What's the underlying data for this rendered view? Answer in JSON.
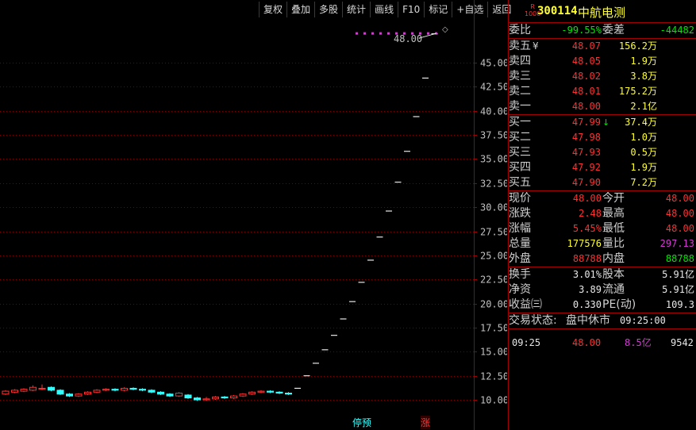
{
  "toolbar": [
    "复权",
    "叠加",
    "多股",
    "统计",
    "画线",
    "F10",
    "标记",
    "+自选",
    "返回"
  ],
  "chart": {
    "y_labels": [
      "45.00",
      "42.50",
      "40.00",
      "37.50",
      "35.00",
      "32.50",
      "30.00",
      "27.50",
      "25.00",
      "22.50",
      "20.00",
      "17.50",
      "15.00",
      "12.50",
      "10.00"
    ],
    "last_price_label": "48.00",
    "diamond": "◇",
    "halt_tag": "停预",
    "rise_tag": "涨",
    "colors": {
      "up": "#ff3030",
      "down": "#33ffff",
      "line": "#d23cd2"
    }
  },
  "chart_data": {
    "type": "candlestick",
    "ylim": [
      9.0,
      48.5
    ],
    "y_ticks": [
      45.0,
      42.5,
      40.0,
      37.5,
      35.0,
      32.5,
      30.0,
      27.5,
      25.0,
      22.5,
      20.0,
      17.5,
      15.0,
      12.5,
      10.0
    ],
    "candles": [
      {
        "o": 10.6,
        "c": 10.9,
        "h": 11.0,
        "l": 10.5
      },
      {
        "o": 10.8,
        "c": 11.0,
        "h": 11.1,
        "l": 10.7
      },
      {
        "o": 10.9,
        "c": 11.1,
        "h": 11.2,
        "l": 10.8
      },
      {
        "o": 11.0,
        "c": 11.3,
        "h": 11.5,
        "l": 10.9
      },
      {
        "o": 11.2,
        "c": 11.2,
        "h": 11.6,
        "l": 11.0
      },
      {
        "o": 11.3,
        "c": 11.0,
        "h": 11.4,
        "l": 10.9
      },
      {
        "o": 11.0,
        "c": 10.6,
        "h": 11.1,
        "l": 10.5
      },
      {
        "o": 10.6,
        "c": 10.4,
        "h": 10.7,
        "l": 10.3
      },
      {
        "o": 10.4,
        "c": 10.6,
        "h": 10.7,
        "l": 10.3
      },
      {
        "o": 10.6,
        "c": 10.8,
        "h": 10.9,
        "l": 10.5
      },
      {
        "o": 10.8,
        "c": 11.0,
        "h": 11.1,
        "l": 10.7
      },
      {
        "o": 11.0,
        "c": 11.1,
        "h": 11.2,
        "l": 10.9
      },
      {
        "o": 11.1,
        "c": 11.0,
        "h": 11.2,
        "l": 10.9
      },
      {
        "o": 11.0,
        "c": 11.2,
        "h": 11.3,
        "l": 10.9
      },
      {
        "o": 11.2,
        "c": 11.1,
        "h": 11.3,
        "l": 11.0
      },
      {
        "o": 11.1,
        "c": 11.0,
        "h": 11.2,
        "l": 10.9
      },
      {
        "o": 11.0,
        "c": 10.8,
        "h": 11.1,
        "l": 10.7
      },
      {
        "o": 10.8,
        "c": 10.6,
        "h": 10.9,
        "l": 10.5
      },
      {
        "o": 10.6,
        "c": 10.4,
        "h": 10.7,
        "l": 10.3
      },
      {
        "o": 10.4,
        "c": 10.7,
        "h": 10.8,
        "l": 10.3
      },
      {
        "o": 10.5,
        "c": 10.2,
        "h": 10.6,
        "l": 10.1
      },
      {
        "o": 10.2,
        "c": 10.0,
        "h": 10.3,
        "l": 9.9
      },
      {
        "o": 10.0,
        "c": 10.1,
        "h": 10.3,
        "l": 9.9
      },
      {
        "o": 10.1,
        "c": 10.3,
        "h": 10.4,
        "l": 10.0
      },
      {
        "o": 10.3,
        "c": 10.2,
        "h": 10.4,
        "l": 10.1
      },
      {
        "o": 10.2,
        "c": 10.4,
        "h": 10.5,
        "l": 10.1
      },
      {
        "o": 10.4,
        "c": 10.6,
        "h": 10.7,
        "l": 10.3
      },
      {
        "o": 10.6,
        "c": 10.8,
        "h": 10.9,
        "l": 10.5
      },
      {
        "o": 10.8,
        "c": 10.9,
        "h": 11.0,
        "l": 10.7
      },
      {
        "o": 10.9,
        "c": 10.8,
        "h": 11.0,
        "l": 10.7
      },
      {
        "o": 10.8,
        "c": 10.7,
        "h": 10.9,
        "l": 10.6
      },
      {
        "o": 10.7,
        "c": 10.6,
        "h": 10.8,
        "l": 10.5
      },
      {
        "o": 11.2,
        "c": 11.2,
        "h": 11.2,
        "l": 11.2
      },
      {
        "o": 12.5,
        "c": 12.5,
        "h": 12.5,
        "l": 12.5
      },
      {
        "o": 13.8,
        "c": 13.8,
        "h": 13.8,
        "l": 13.8
      },
      {
        "o": 15.2,
        "c": 15.2,
        "h": 15.2,
        "l": 15.2
      },
      {
        "o": 16.7,
        "c": 16.7,
        "h": 16.7,
        "l": 16.7
      },
      {
        "o": 18.4,
        "c": 18.4,
        "h": 18.4,
        "l": 18.4
      },
      {
        "o": 20.2,
        "c": 20.2,
        "h": 20.2,
        "l": 20.2
      },
      {
        "o": 22.2,
        "c": 22.2,
        "h": 22.2,
        "l": 22.2
      },
      {
        "o": 24.5,
        "c": 24.5,
        "h": 24.5,
        "l": 24.5
      },
      {
        "o": 26.9,
        "c": 26.9,
        "h": 26.9,
        "l": 26.9
      },
      {
        "o": 29.6,
        "c": 29.6,
        "h": 29.6,
        "l": 29.6
      },
      {
        "o": 32.6,
        "c": 32.6,
        "h": 32.6,
        "l": 32.6
      },
      {
        "o": 35.8,
        "c": 35.8,
        "h": 35.8,
        "l": 35.8
      },
      {
        "o": 39.4,
        "c": 39.4,
        "h": 39.4,
        "l": 39.4
      },
      {
        "o": 43.4,
        "c": 43.4,
        "h": 43.4,
        "l": 43.4
      },
      {
        "o": 48.0,
        "c": 48.0,
        "h": 48.0,
        "l": 48.0
      }
    ],
    "limit_line_value": 48.0
  },
  "stock": {
    "badge_top": "R",
    "badge_bottom": "1000",
    "code": "300114",
    "name": "中航电测"
  },
  "committee": {
    "ratio_label": "委比",
    "ratio_value": "-99.55%",
    "diff_label": "委差",
    "diff_value": "-44482"
  },
  "asks": [
    {
      "label": "卖五",
      "price": "48.07",
      "vol": "156.2万",
      "mark": "¥"
    },
    {
      "label": "卖四",
      "price": "48.05",
      "vol": "1.9万"
    },
    {
      "label": "卖三",
      "price": "48.02",
      "vol": "3.8万"
    },
    {
      "label": "卖二",
      "price": "48.01",
      "vol": "175.2万"
    },
    {
      "label": "卖一",
      "price": "48.00",
      "vol": "2.1亿"
    }
  ],
  "bids": [
    {
      "label": "买一",
      "price": "47.99",
      "vol": "37.4万",
      "arrow": "↓"
    },
    {
      "label": "买二",
      "price": "47.98",
      "vol": "1.0万"
    },
    {
      "label": "买三",
      "price": "47.93",
      "vol": "0.5万"
    },
    {
      "label": "买四",
      "price": "47.92",
      "vol": "1.9万"
    },
    {
      "label": "买五",
      "price": "47.90",
      "vol": "7.2万"
    }
  ],
  "stats": [
    {
      "l1": "现价",
      "v1": "48.00",
      "c1": "red",
      "l2": "今开",
      "v2": "48.00",
      "c2": "red"
    },
    {
      "l1": "涨跌",
      "v1": "2.48",
      "c1": "red",
      "l2": "最高",
      "v2": "48.00",
      "c2": "red"
    },
    {
      "l1": "涨幅",
      "v1": "5.45%",
      "c1": "red",
      "l2": "最低",
      "v2": "48.00",
      "c2": "red"
    },
    {
      "l1": "总量",
      "v1": "177576",
      "c1": "yellow",
      "l2": "量比",
      "v2": "297.13",
      "c2": "magenta"
    },
    {
      "l1": "外盘",
      "v1": "88788",
      "c1": "red",
      "l2": "内盘",
      "v2": "88788",
      "c2": "green"
    }
  ],
  "fund": [
    {
      "l1": "换手",
      "v1": "3.01%",
      "l2": "股本",
      "v2": "5.91亿"
    },
    {
      "l1": "净资",
      "v1": "3.89",
      "l2": "流通",
      "v2": "5.91亿"
    },
    {
      "l1": "收益㈢",
      "v1": "0.330",
      "l2": "PE(动)",
      "v2": "109.3"
    }
  ],
  "status": {
    "label": "交易状态:",
    "value": "盘中休市",
    "time": "09:25:00"
  },
  "tick": {
    "time": "09:25",
    "price": "48.00",
    "amount": "8.5亿",
    "vol": "9542"
  }
}
